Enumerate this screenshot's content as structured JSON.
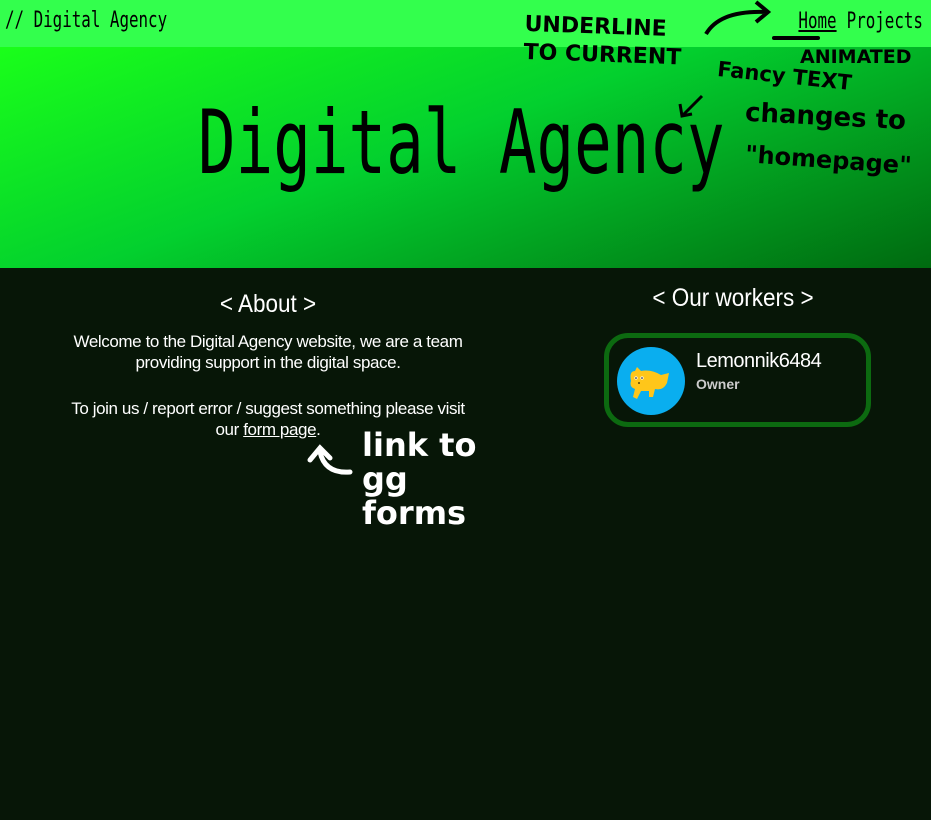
{
  "nav": {
    "brand": "// Digital Agency",
    "links": [
      {
        "label": "Home",
        "current": true
      },
      {
        "label": "Projects",
        "current": false
      }
    ]
  },
  "hero": {
    "title": "Digital Agency"
  },
  "about": {
    "heading": "< About >",
    "p1": "Welcome to the Digital Agency website, we are a team providing support in the digital space.",
    "p2_before": "To join us / report error / suggest something please visit our ",
    "p2_link": "form page",
    "p2_after": "."
  },
  "workers": {
    "heading": "< Our workers >",
    "items": [
      {
        "name": "Lemonnik6484",
        "role": "Owner"
      }
    ]
  },
  "annotations": {
    "nav": "UNDERLINE TO CURRENT",
    "hero1": "ANIMATED",
    "hero2": "Fancy TEXT",
    "hero3": "changes to",
    "hero4": "\"homepage\"",
    "link": "link to gg forms"
  },
  "colors": {
    "nav_bg": "#33ff4d",
    "body_bg": "#071607",
    "card_border": "#0c6a10",
    "avatar_bg": "#0aaeef"
  }
}
